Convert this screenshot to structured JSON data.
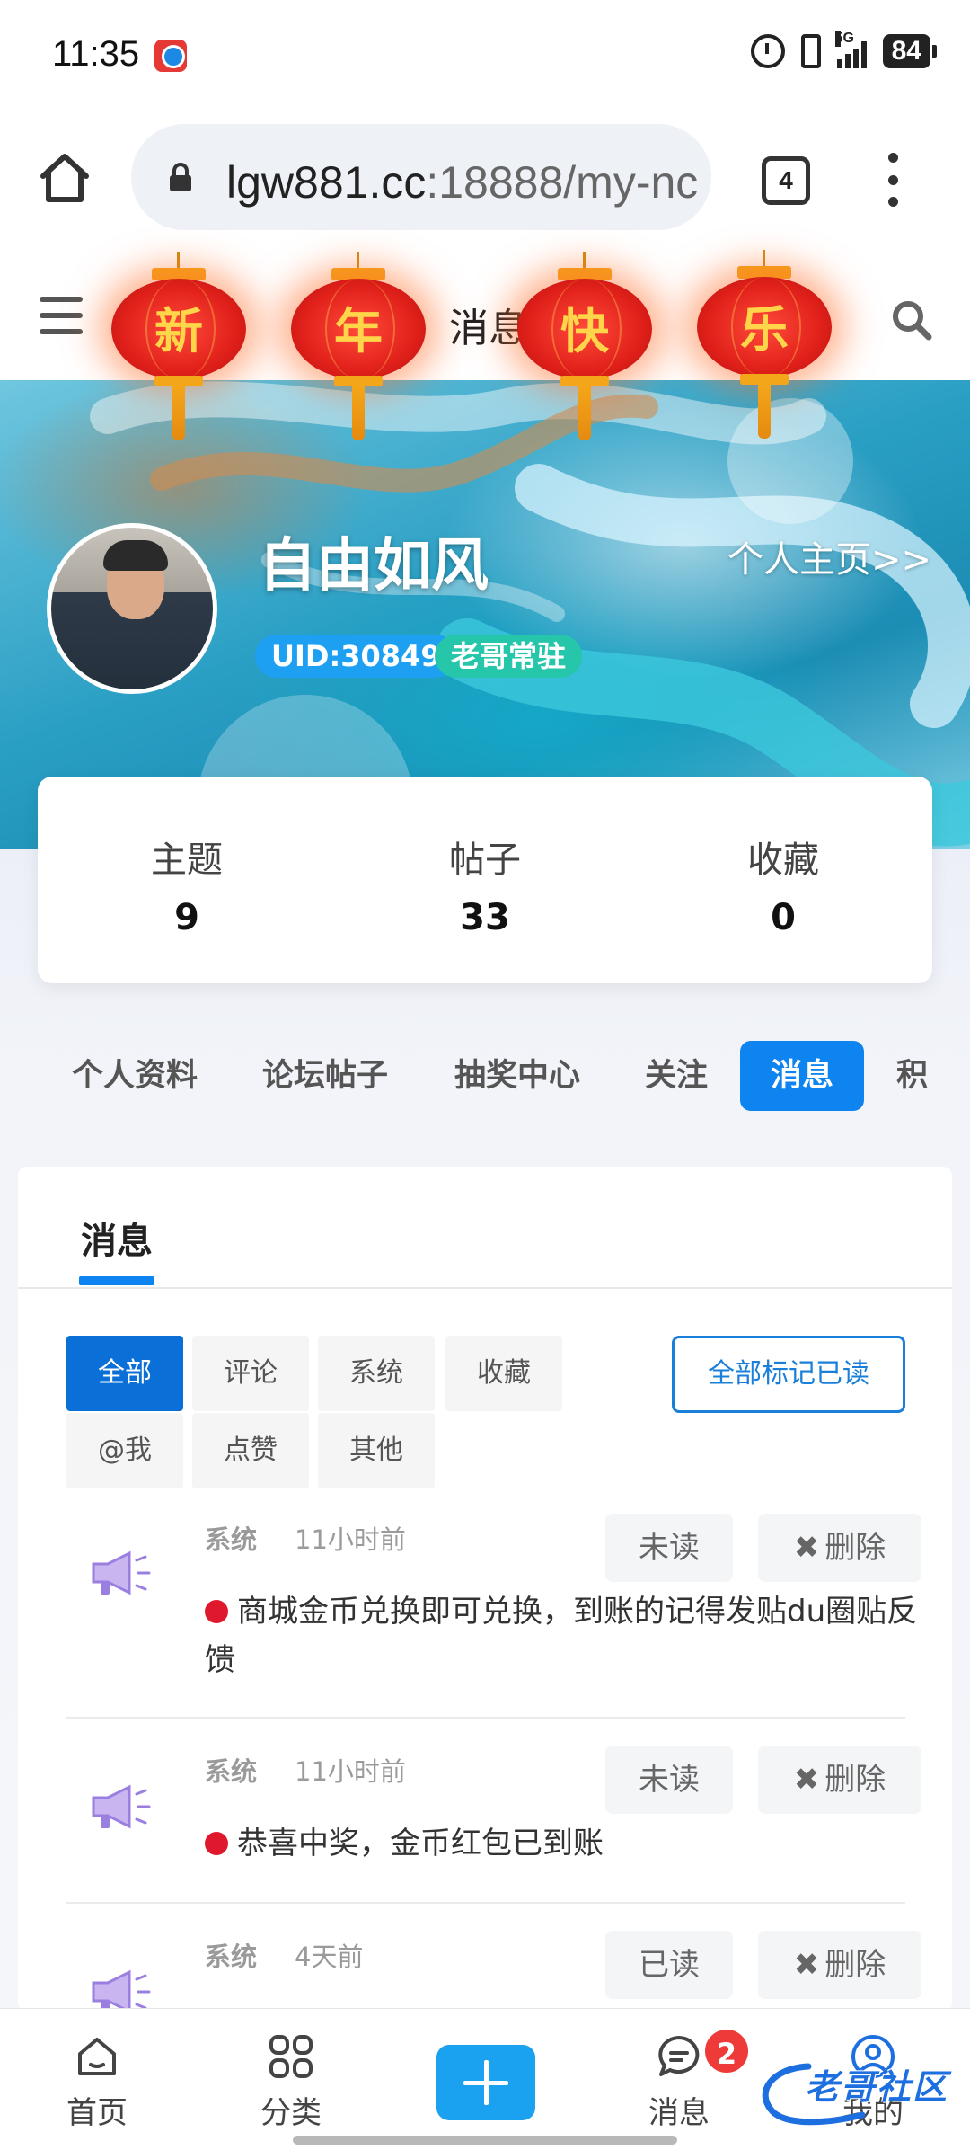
{
  "status_bar": {
    "time": "11:35",
    "network": "5G",
    "battery": "84",
    "icons": [
      "app-notification-icon",
      "alarm-icon",
      "vibrate-icon",
      "signal-icon"
    ]
  },
  "browser": {
    "url_host": "lgw881.cc",
    "url_rest": ":18888/my-nc",
    "tab_count": "4",
    "icons": [
      "home-icon",
      "lock-icon",
      "tabs-icon",
      "more-vert-icon"
    ]
  },
  "header": {
    "title": "消息",
    "lanterns": [
      "新",
      "年",
      "快",
      "乐"
    ],
    "icons": [
      "menu-icon",
      "search-icon"
    ]
  },
  "profile": {
    "username": "自由如风",
    "uid": "UID:30849",
    "level": "老哥常驻",
    "homepage_link": "个人主页>>"
  },
  "stats": [
    {
      "label": "主题",
      "value": "9"
    },
    {
      "label": "帖子",
      "value": "33"
    },
    {
      "label": "收藏",
      "value": "0"
    }
  ],
  "nav_tabs": [
    {
      "label": "个人资料",
      "active": false
    },
    {
      "label": "论坛帖子",
      "active": false
    },
    {
      "label": "抽奖中心",
      "active": false
    },
    {
      "label": "关注",
      "active": false
    },
    {
      "label": "消息",
      "active": true
    },
    {
      "label": "积",
      "active": false
    }
  ],
  "messages_panel": {
    "title": "消息",
    "filters": [
      {
        "label": "全部",
        "active": true
      },
      {
        "label": "评论",
        "active": false
      },
      {
        "label": "系统",
        "active": false
      },
      {
        "label": "收藏",
        "active": false
      },
      {
        "label": "@我",
        "active": false
      },
      {
        "label": "点赞",
        "active": false
      },
      {
        "label": "其他",
        "active": false
      }
    ],
    "mark_all_read": "全部标记已读",
    "delete_label": "删除",
    "items": [
      {
        "type": "系统",
        "time": "11小时前",
        "status": "未读",
        "text": "商城金币兑换即可兑换，到账的记得发贴du圈贴反馈"
      },
      {
        "type": "系统",
        "time": "11小时前",
        "status": "未读",
        "text": "恭喜中奖，金币红包已到账"
      },
      {
        "type": "系统",
        "time": "4天前",
        "status": "已读",
        "text": ""
      }
    ]
  },
  "bottom_nav": {
    "items": [
      {
        "label": "首页",
        "icon": "home-icon"
      },
      {
        "label": "分类",
        "icon": "grid-icon"
      },
      {
        "label": "",
        "icon": "plus-icon"
      },
      {
        "label": "消息",
        "icon": "chat-icon"
      },
      {
        "label": "我的",
        "icon": "user-icon"
      }
    ],
    "message_badge": "2",
    "watermark": "老哥社区"
  },
  "colors": {
    "primary": "#0d84f0",
    "active_filter": "#0a6fd6",
    "unread_dot": "#e0182e",
    "uid_badge": "#1ea0f2",
    "level_badge": "#25c6a9",
    "lantern_red": "#e0201a",
    "lantern_gold": "#f4a61a"
  }
}
